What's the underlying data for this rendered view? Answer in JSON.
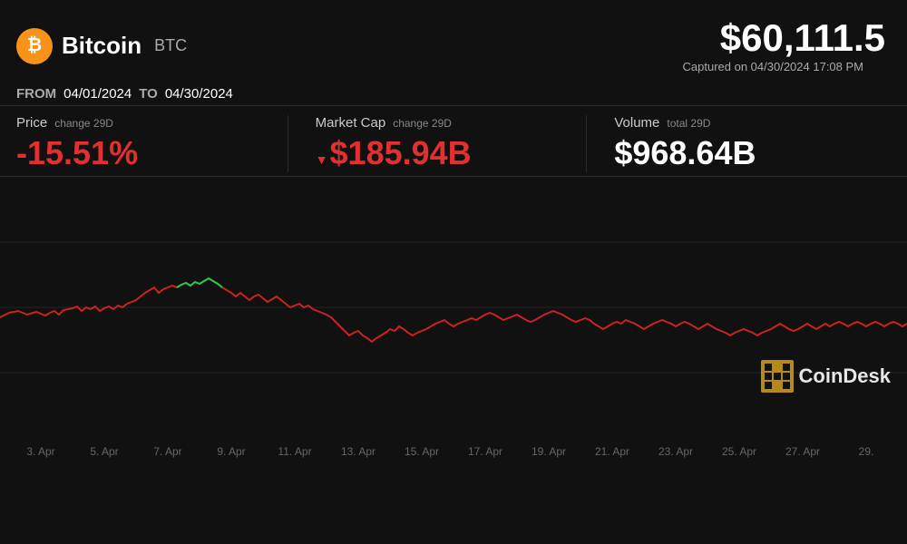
{
  "brand": {
    "name": "Bitcoin",
    "ticker": "BTC",
    "logo_symbol": "₿"
  },
  "price": {
    "current": "$60,111.5",
    "display": "$60,111.5"
  },
  "date_range": {
    "from_label": "FROM",
    "from_value": "04/01/2024",
    "to_label": "TO",
    "to_value": "04/30/2024",
    "captured": "Captured on 04/30/2024 17:08 PM"
  },
  "stats": {
    "price": {
      "label": "Price",
      "sublabel": "change 29D",
      "value": "-15.51%"
    },
    "market_cap": {
      "label": "Market Cap",
      "sublabel": "change 29D",
      "value": "$185.94B",
      "arrow": "▼"
    },
    "volume": {
      "label": "Volume",
      "sublabel": "total 29D",
      "value": "$968.64B"
    }
  },
  "chart": {
    "x_labels": [
      "3. Apr",
      "5. Apr",
      "7. Apr",
      "9. Apr",
      "11. Apr",
      "13. Apr",
      "15. Apr",
      "17. Apr",
      "19. Apr",
      "21. Apr",
      "23. Apr",
      "25. Apr",
      "27. Apr",
      "29."
    ]
  },
  "coindesk": {
    "text": "CoinDesk"
  }
}
